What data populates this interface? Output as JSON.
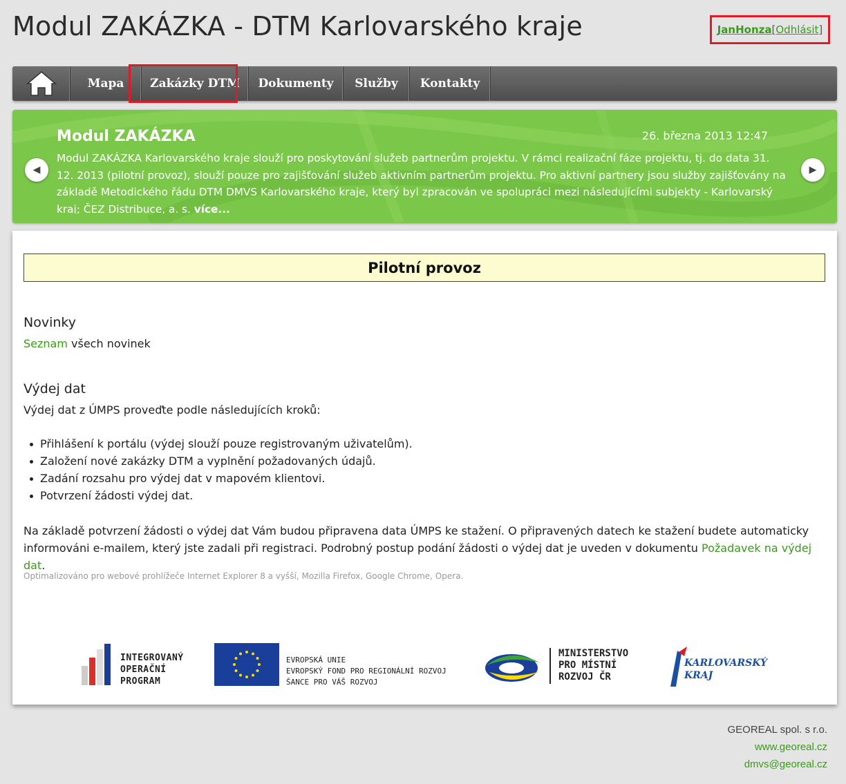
{
  "header": {
    "title": "Modul ZAKÁZKA - DTM Karlovarského kraje",
    "user_name": "JanHonza",
    "logout_open": "[",
    "logout_label": "Odhlásit",
    "logout_close": "]"
  },
  "nav": {
    "home_icon": "home-icon",
    "items": [
      {
        "label": "Mapa"
      },
      {
        "label": "Zakázky DTM",
        "active": true
      },
      {
        "label": "Dokumenty"
      },
      {
        "label": "Služby"
      },
      {
        "label": "Kontakty"
      }
    ]
  },
  "banner": {
    "title": "Modul ZAKÁZKA",
    "date": "26. března 2013 12:47",
    "text": "Modul ZAKÁZKA Karlovarského kraje slouží pro poskytování služeb partnerům projektu. V rámci realizační fáze projektu, tj. do data 31. 12. 2013 (pilotní provoz), slouží pouze pro zajišťování služeb aktivním partnerům projektu. Pro aktivní partnery jsou služby zajišťovány na základě Metodického řádu DTM DMVS Karlovarského kraje, který byl zpracován ve spolupráci mezi následujícími subjekty - Karlovarský kraj; ČEZ Distribuce, a. s. ",
    "more": "více...",
    "prev_icon": "arrow-left-icon",
    "next_icon": "arrow-right-icon",
    "color": "#7bc74a"
  },
  "main": {
    "pilot_title": "Pilotní provoz",
    "news_heading": "Novinky",
    "news_link": "Seznam",
    "news_rest": " všech novinek",
    "data_heading": "Výdej dat",
    "data_intro": "Výdej dat z ÚMPS proveďte podle následujících kroků:",
    "steps": [
      "Přihlášení k portálu (výdej slouží pouze registrovaným uživatelům).",
      "Založení nové zakázky DTM a vyplnění požadovaných údajů.",
      "Zadání rozsahu pro výdej dat v mapovém klientovi.",
      "Potvrzení žádosti výdej dat."
    ],
    "paragraph": "Na základě potvrzení žádosti o výdej dat Vám budou připravena data ÚMPS ke stažení. O připravených datech ke stažení budete automaticky informováni e-mailem, který jste zadali při registraci. Podrobný postup podání žádosti o výdej dat je uveden v dokumentu ",
    "paragraph_link": "Požadavek na výdej dat",
    "paragraph_end": ".",
    "optimized": "Optimalizováno pro webové prohlížeče Internet Explorer 8 a vyšší, Mozilla Firefox, Google Chrome, Opera."
  },
  "logos": {
    "iop": [
      "INTEGROVANÝ",
      "OPERAČNÍ",
      "PROGRAM"
    ],
    "eu": [
      "EVROPSKÁ UNIE",
      "EVROPSKÝ FOND PRO REGIONÁLNÍ ROZVOJ",
      "ŠANCE PRO VÁŠ ROZVOJ"
    ],
    "mmr": [
      "MINISTERSTVO",
      "PRO MÍSTNÍ",
      "ROZVOJ ČR"
    ],
    "kk": [
      "KARLOVARSKÝ",
      "KRAJ"
    ]
  },
  "footer": {
    "company": "GEOREAL spol. s r.o.",
    "web": "www.georeal.cz",
    "email": "dmvs@georeal.cz"
  },
  "colors": {
    "accent_green": "#3a9a1a",
    "highlight_red": "#e21a25",
    "nav_gray": "#5a5a5a",
    "pilot_bg": "#fdfcd1"
  }
}
